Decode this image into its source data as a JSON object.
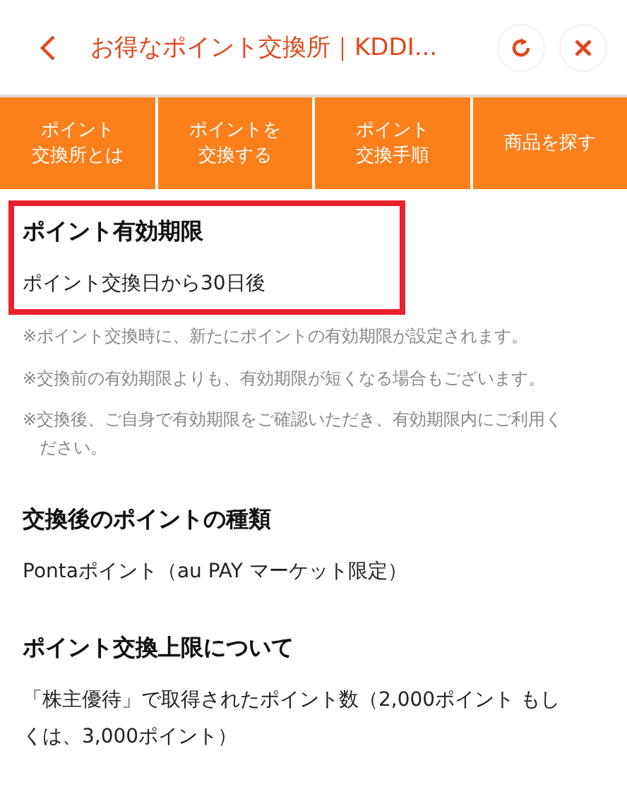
{
  "header": {
    "title": "お得なポイント交換所｜KDDI..."
  },
  "tabs": [
    {
      "lines": [
        "ポイント",
        "交換所とは"
      ]
    },
    {
      "lines": [
        "ポイントを",
        "交換する"
      ]
    },
    {
      "lines": [
        "ポイント",
        "交換手順"
      ]
    },
    {
      "lines": [
        "商品を探す"
      ]
    }
  ],
  "sections": [
    {
      "heading": "ポイント有効期限",
      "body": "ポイント交換日から30日後",
      "highlighted": true,
      "notes": [
        "※ポイント交換時に、新たにポイントの有効期限が設定されます。",
        "※交換前の有効期限よりも、有効期限が短くなる場合もございます。",
        "※交換後、ご自身で有効期限をご確認いただき、有効期限内にご利用ください。"
      ]
    },
    {
      "heading": "交換後のポイントの種類",
      "body": "Pontaポイント（au PAY マーケット限定）",
      "highlighted": false
    },
    {
      "heading": "ポイント交換上限について",
      "body": "「株主優待」で取得されたポイント数（2,000ポイント もしくは、3,000ポイント）",
      "highlighted": false
    }
  ]
}
